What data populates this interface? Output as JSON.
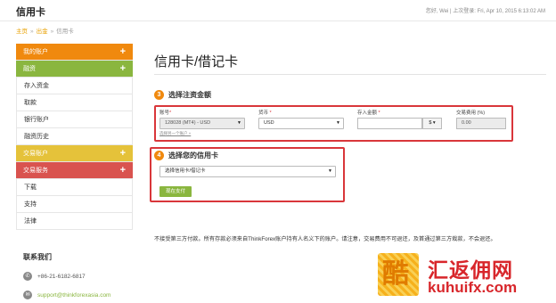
{
  "header": {
    "title": "信用卡",
    "user_info": "您好, Wei | 上次登录: Fri, Apr 10, 2015 6:13:02 AM"
  },
  "breadcrumb": [
    "主页",
    "出金",
    "信用卡"
  ],
  "sidebar": {
    "items": [
      {
        "label": "我的账户",
        "style": "orange",
        "expandable": true
      },
      {
        "label": "融资",
        "style": "green",
        "expandable": true
      },
      {
        "label": "存入资金",
        "style": "plain",
        "expandable": false
      },
      {
        "label": "取款",
        "style": "plain",
        "expandable": false
      },
      {
        "label": "银行账户",
        "style": "plain",
        "expandable": false
      },
      {
        "label": "融资历史",
        "style": "plain",
        "expandable": false
      },
      {
        "label": "交易账户",
        "style": "yellow",
        "expandable": true
      },
      {
        "label": "交易服务",
        "style": "red",
        "expandable": true
      },
      {
        "label": "下载",
        "style": "plain",
        "expandable": false
      },
      {
        "label": "支持",
        "style": "plain",
        "expandable": false
      },
      {
        "label": "法律",
        "style": "plain",
        "expandable": false
      }
    ]
  },
  "contact": {
    "heading": "联系我们",
    "phone": "+86-21-6182-6817",
    "email": "support@thinkforexasia.com"
  },
  "main": {
    "title": "信用卡/借记卡",
    "step3": {
      "number": "3",
      "title": "选择注资金额",
      "account_label": "账号",
      "account_value": "128028 (MT4) - USD",
      "account_link": "选择另一个账户 »",
      "currency_label": "货币",
      "currency_value": "USD",
      "amount_label": "存入金额",
      "amount_value": "",
      "amount_addon": "$ ▾",
      "fee_label": "交易费用 (%)",
      "fee_value": "0.00"
    },
    "step4": {
      "number": "4",
      "title": "选择您的信用卡",
      "card_value": "选择信用卡/借记卡",
      "pay_button": "现在支付"
    },
    "notice": "不接受第三方付款。所有存款必须来自ThinkForex账户持有人名义下的账户。请注意，交易费用不可退还，及首通过第三方栽款，不会退还。"
  },
  "watermark": {
    "seal_char": "酷",
    "cn_text": "汇返佣网",
    "en_text": "kuhuifx.com"
  },
  "colors": {
    "accent_orange": "#f0890e",
    "accent_green": "#8ab63f",
    "accent_yellow": "#e5c23a",
    "accent_red": "#d9534f",
    "highlight_box": "#d9363a"
  }
}
